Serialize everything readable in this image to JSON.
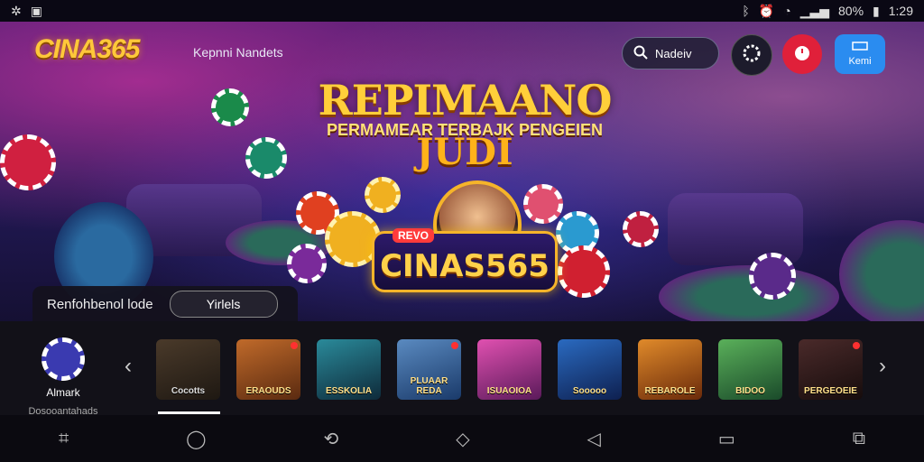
{
  "status": {
    "time": "1:29",
    "battery": "80%"
  },
  "header": {
    "logo": "CINA365",
    "subnav": "Kepnni Nandets",
    "search_label": "Nadeiv",
    "login_label": "Kemi"
  },
  "hero": {
    "title": "REPIMAANO",
    "subtitle": "PERMAMEAR TERBAJK PENGEIEN",
    "title2": "JUDI",
    "badge_tag": "REVO",
    "badge_name": "CINAS565"
  },
  "promo": {
    "label": "Renfohbenol lode",
    "button": "Yirlels"
  },
  "sidebar": {
    "label": "Almark",
    "sub": "Dosooantahads"
  },
  "games": [
    {
      "label": "Cocotts",
      "color": "#3b2a1e",
      "dot": false
    },
    {
      "label": "ERAOUDS",
      "color": "#8a3a1a",
      "dot": true
    },
    {
      "label": "ESSKOLIA",
      "color": "#1a5a6a",
      "dot": false
    },
    {
      "label": "PLUAAR REDA",
      "color": "#3a6a9a",
      "dot": true
    },
    {
      "label": "ISUAOIOA",
      "color": "#c03aa0",
      "dot": false
    },
    {
      "label": "Sooooo",
      "color": "#1a4a8a",
      "dot": false
    },
    {
      "label": "REBAROLE",
      "color": "#c06a1a",
      "dot": false
    },
    {
      "label": "BIDOO",
      "color": "#3a8a4a",
      "dot": false
    },
    {
      "label": "PERGEOEIE",
      "color": "#2a1a1a",
      "dot": true
    }
  ]
}
